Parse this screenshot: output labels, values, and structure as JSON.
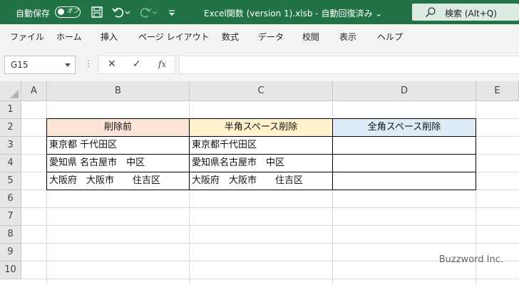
{
  "titlebar": {
    "autosave_label": "自動保存",
    "autosave_state": "オフ",
    "filename": "Excel関数 (version 1).xlsb  -  自動回復済み  ⌄",
    "search_label": "検索 (Alt+Q)",
    "bg_color": "#217346"
  },
  "ribbon": {
    "tabs": [
      "ファイル",
      "ホーム",
      "挿入",
      "ページ レイアウト",
      "数式",
      "データ",
      "校閲",
      "表示",
      "ヘルプ"
    ]
  },
  "formula_bar": {
    "name_box": "G15",
    "cancel_icon": "✕",
    "enter_icon": "✓",
    "fx_icon": "fx",
    "formula": ""
  },
  "grid": {
    "columns": [
      "A",
      "B",
      "C",
      "D",
      "E"
    ],
    "rows": [
      "1",
      "2",
      "3",
      "4",
      "5",
      "6",
      "7",
      "8",
      "9",
      "10"
    ]
  },
  "table": {
    "headers": [
      {
        "text": "削除前",
        "color": "#fce4d6"
      },
      {
        "text": "半角スペース削除",
        "color": "#fff2cc"
      },
      {
        "text": "全角スペース削除",
        "color": "#ddebf7"
      }
    ],
    "rows": [
      [
        "東京都 千代田区",
        "東京都千代田区",
        ""
      ],
      [
        "愛知県 名古屋市　中区",
        "愛知県名古屋市　中区",
        ""
      ],
      [
        "大阪府　大阪市　　住吉区",
        "大阪府　大阪市　　住吉区",
        ""
      ]
    ]
  },
  "watermark": "Buzzword Inc."
}
